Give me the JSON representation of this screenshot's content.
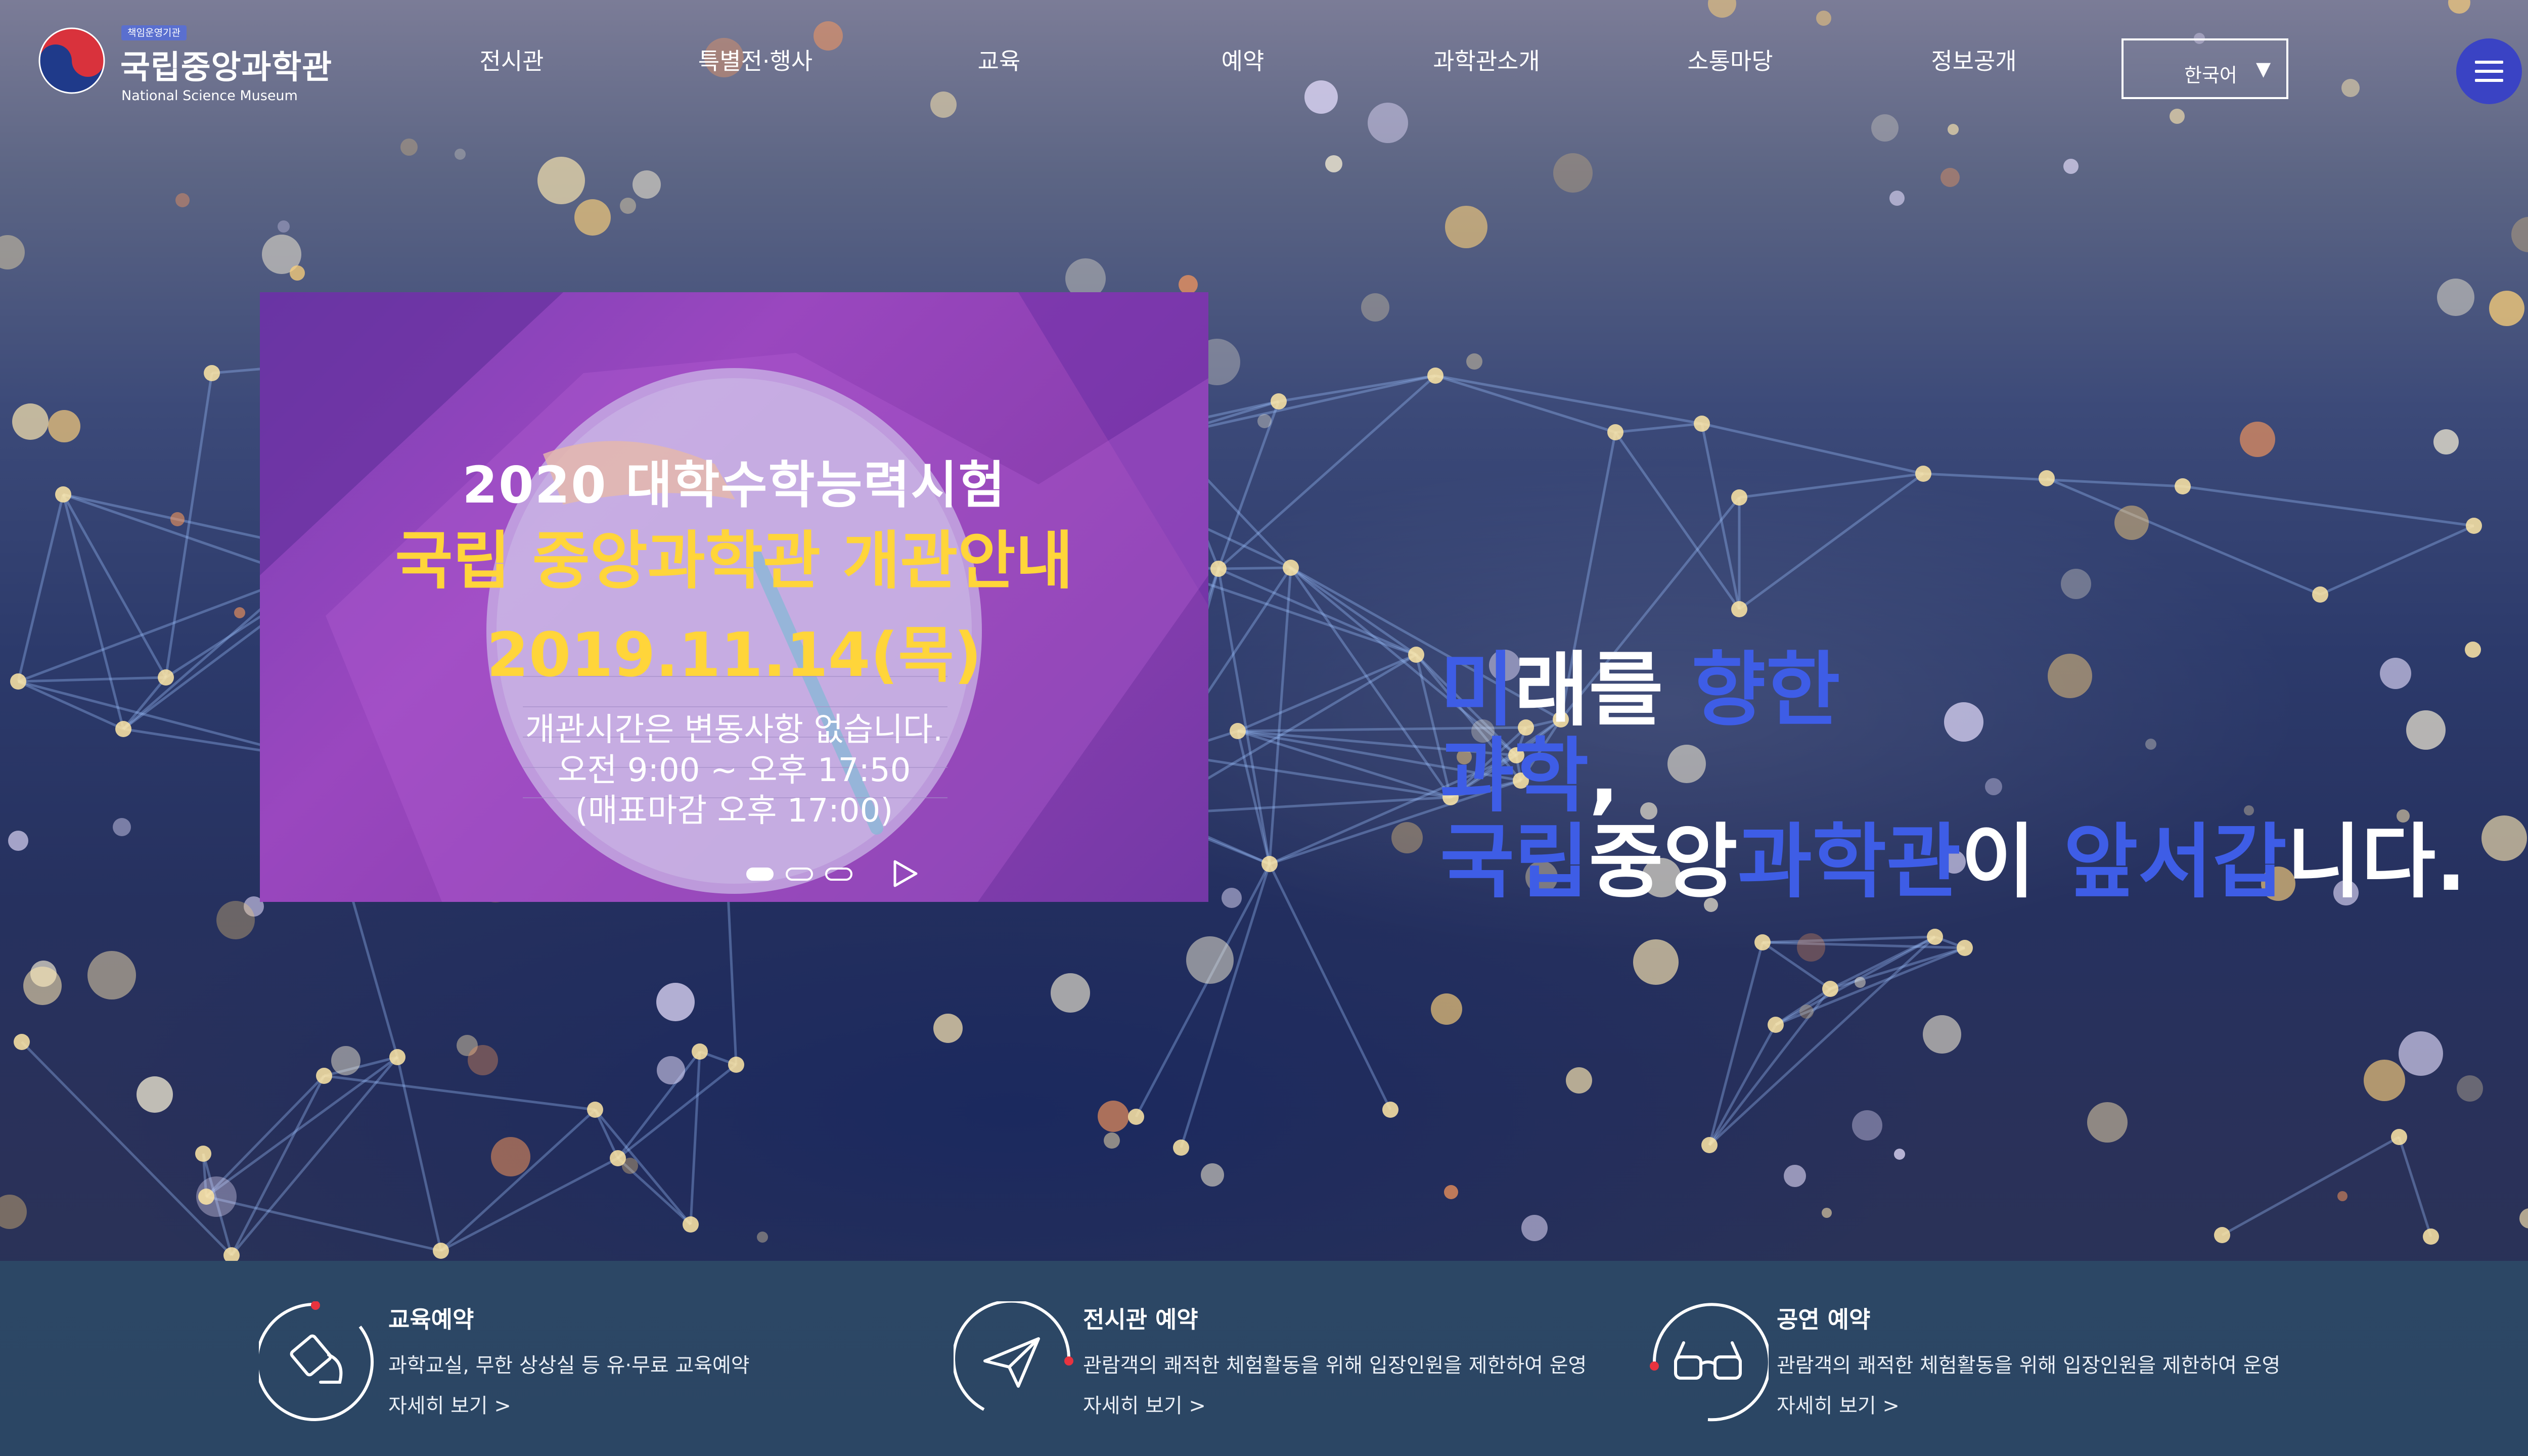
{
  "header": {
    "logo_badge": "책임운영기관",
    "logo_name_kr": "국립중앙과학관",
    "logo_name_en": "National Science Museum",
    "nav": [
      "전시관",
      "특별전·행사",
      "교육",
      "예약",
      "과학관소개",
      "소통마당",
      "정보공개"
    ],
    "language": "한국어",
    "language_caret": "▼"
  },
  "slide": {
    "line1": "2020  대학수학능력시험",
    "line2": "국립 중앙과학관 개관안내",
    "line3": "2019.11.14(목)",
    "line4": "개관시간은 변동사항 없습니다.",
    "line5": "오전 9:00 ~ 오후 17:50",
    "line6": "(매표마감 오후 17:00)",
    "dot_count": 3,
    "active_dot": 1
  },
  "slogan": {
    "line1": [
      {
        "t": "미",
        "c": "hl"
      },
      {
        "t": "래를 ",
        "c": "wt"
      },
      {
        "t": "향한",
        "c": "hl"
      }
    ],
    "line2": [
      {
        "t": "과학",
        "c": "hl"
      },
      {
        "t": ",",
        "c": "wt"
      }
    ],
    "line3": [
      {
        "t": "국립",
        "c": "hl"
      },
      {
        "t": "중앙",
        "c": "wt"
      },
      {
        "t": "과학관",
        "c": "hl"
      },
      {
        "t": "이 ",
        "c": "wt"
      },
      {
        "t": "앞서갑",
        "c": "hl"
      },
      {
        "t": "니다.",
        "c": "wt"
      }
    ]
  },
  "quick_links": [
    {
      "title": "교육예약",
      "desc": "과학교실, 무한 상상실 등 유·무료 교육예약",
      "more": "자세히 보기  >",
      "icon": "edu-reservation-icon"
    },
    {
      "title": "전시관 예약",
      "desc": "관람객의 쾌적한 체험활동을 위해 입장인원을 제한하여 운영",
      "more": "자세히 보기  >",
      "icon": "paper-plane-icon"
    },
    {
      "title": "공연 예약",
      "desc": "관람객의 쾌적한 체험활동을 위해 입장인원을 제한하여 운영",
      "more": "자세히 보기  >",
      "icon": "glasses-icon"
    }
  ],
  "colors": {
    "accent_blue": "#3e5de6",
    "menu_button": "#3a43c4",
    "slide_yellow": "#ffd53a",
    "quick_bar": "#2c4765",
    "icon_red": "#e8333f"
  }
}
